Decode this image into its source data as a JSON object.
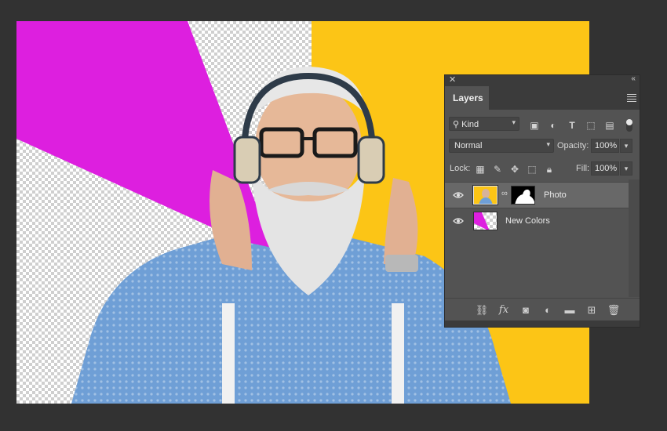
{
  "document": {
    "background_colors": {
      "magenta": "#dd1fdf",
      "yellow": "#fcc516",
      "panel": "#535353",
      "workspace": "#323232"
    }
  },
  "layers_panel": {
    "tab_label": "Layers",
    "close_icon": "close-icon",
    "collapse_icon": "double-chevron-icon",
    "menu_icon": "panel-menu-icon",
    "filter": {
      "kind_label": "Kind",
      "icons": [
        "image-filter-icon",
        "adjustment-filter-icon",
        "type-filter-icon",
        "shape-filter-icon",
        "smart-object-filter-icon"
      ]
    },
    "blend_mode": "Normal",
    "opacity_label": "Opacity:",
    "opacity_value": "100%",
    "lock_label": "Lock:",
    "fill_label": "Fill:",
    "fill_value": "100%",
    "layers": [
      {
        "name": "Photo",
        "visible": true,
        "selected": true,
        "has_mask": true
      },
      {
        "name": "New Colors",
        "visible": true,
        "selected": false,
        "has_mask": false
      }
    ],
    "bottom_icons": [
      "link-icon",
      "fx-icon",
      "add-mask-icon",
      "adjustment-layer-icon",
      "group-folder-icon",
      "new-layer-icon",
      "trash-icon"
    ],
    "fx_text": "fx"
  }
}
